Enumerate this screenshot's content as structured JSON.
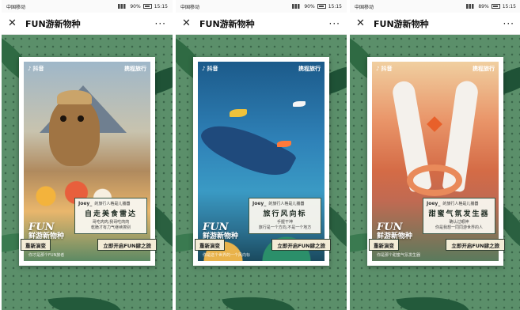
{
  "screens": [
    {
      "status": {
        "carrier": "中国移动",
        "battery": "90%",
        "time": "15:15"
      },
      "nav": {
        "close": "✕",
        "title": "FUN游新物种",
        "more": "···"
      },
      "brand": {
        "left": "抖音",
        "right": "携程旅行"
      },
      "card": {
        "fun_title": "FUN",
        "fun_sub": "鲜游新物种",
        "user": "Joey_",
        "meta": "的旅行人格是儿播器",
        "tag": "自走美食雷达",
        "desc": "哥吃肉肉,我哥吃肉肉\n乾脆才有力气继续撩别",
        "credit": "你才是那个FUN旅者"
      },
      "buttons": {
        "rematch": "重新演变",
        "open": "立即开启FUN肆之旅"
      }
    },
    {
      "status": {
        "carrier": "中国移动",
        "battery": "90%",
        "time": "15:15"
      },
      "nav": {
        "close": "✕",
        "title": "FUN游新物种",
        "more": "···"
      },
      "brand": {
        "left": "抖音",
        "right": "携程旅行"
      },
      "card": {
        "fun_title": "FUN",
        "fun_sub": "鲜游新物种",
        "user": "Joey_",
        "meta": "的旅行人格是儿播器",
        "tag": "旅行风向标",
        "desc": "手握干坤\n旅行是一个方向,不是一个地方",
        "credit": "你是这个世界的一个风向标"
      },
      "buttons": {
        "rematch": "重新演变",
        "open": "立即开启FUN肆之旅"
      }
    },
    {
      "status": {
        "carrier": "中国移动",
        "battery": "89%",
        "time": "15:15"
      },
      "nav": {
        "close": "✕",
        "title": "FUN游新物种",
        "more": "···"
      },
      "brand": {
        "left": "抖音",
        "right": "携程旅行"
      },
      "card": {
        "fun_title": "FUN",
        "fun_sub": "鲜游新物种",
        "user": "Joey_",
        "meta": "的旅行人格是儿播器",
        "tag": "甜蜜气氛发生器",
        "desc": "确认过眼神\n你是我想一同同游世界的人",
        "credit": "你是那个甜蜜气氛发生器"
      },
      "buttons": {
        "rematch": "重新演变",
        "open": "立即开启FUN肆之旅"
      }
    }
  ]
}
